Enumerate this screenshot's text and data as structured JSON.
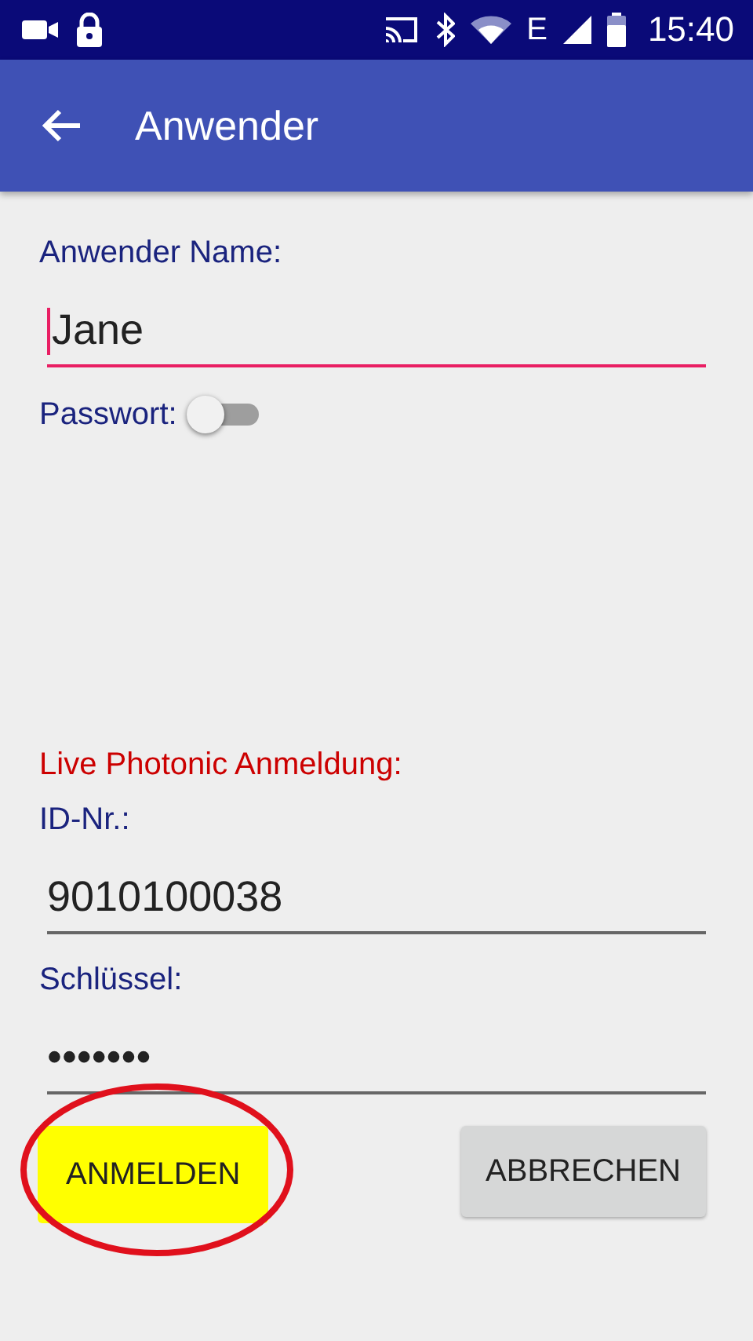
{
  "status_bar": {
    "network": "E",
    "time": "15:40"
  },
  "app_bar": {
    "title": "Anwender"
  },
  "user": {
    "label": "Anwender Name:",
    "value": "Jane",
    "focused": true
  },
  "password_switch": {
    "label": "Passwort:",
    "on": false
  },
  "login_section": {
    "title": "Live Photonic Anmeldung:",
    "fields": [
      {
        "label": "ID-Nr.:",
        "value": "9010100038",
        "focused": false
      },
      {
        "label": "Schlüssel:",
        "value": "•••••••",
        "focused": false
      }
    ]
  },
  "buttons": [
    {
      "label": "ANMELDEN",
      "kind": "highlighted",
      "circled": true
    },
    {
      "label": "ABBRECHEN",
      "kind": "normal",
      "circled": false
    }
  ]
}
